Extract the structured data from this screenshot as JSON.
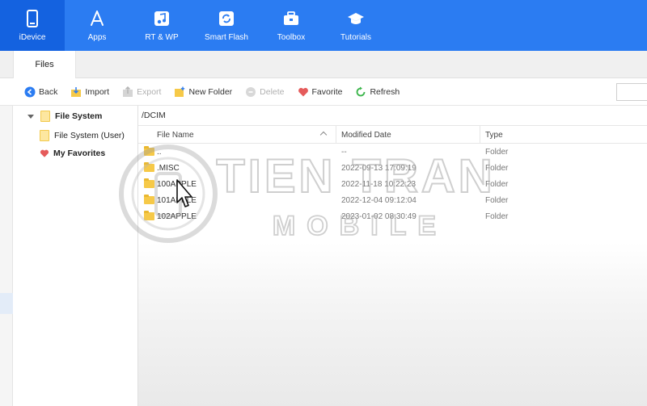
{
  "nav": {
    "items": [
      {
        "label": "iDevice",
        "icon": "phone-icon",
        "active": true
      },
      {
        "label": "Apps",
        "icon": "app-store-icon"
      },
      {
        "label": "RT & WP",
        "icon": "music-icon"
      },
      {
        "label": "Smart Flash",
        "icon": "flash-icon"
      },
      {
        "label": "Toolbox",
        "icon": "toolbox-icon"
      },
      {
        "label": "Tutorials",
        "icon": "graduation-cap-icon"
      }
    ]
  },
  "tabs": {
    "files": "Files"
  },
  "toolbar": {
    "back": "Back",
    "import": "Import",
    "export": "Export",
    "new_folder": "New Folder",
    "delete": "Delete",
    "favorite": "Favorite",
    "refresh": "Refresh"
  },
  "tree": {
    "file_system": "File System",
    "file_system_user": "File System (User)",
    "my_favorites": "My Favorites"
  },
  "path": "/DCIM",
  "table": {
    "headers": {
      "name": "File Name",
      "modified": "Modified Date",
      "type": "Type"
    },
    "rows": [
      {
        "name": "..",
        "modified": "--",
        "type": "Folder"
      },
      {
        "name": ".MISC",
        "modified": "2022-09-13 17:09:19",
        "type": "Folder"
      },
      {
        "name": "100APPLE",
        "modified": "2022-11-18 10:22:23",
        "type": "Folder"
      },
      {
        "name": "101APPLE",
        "modified": "2022-12-04 09:12:04",
        "type": "Folder"
      },
      {
        "name": "102APPLE",
        "modified": "2023-01-02 08:30:49",
        "type": "Folder"
      }
    ]
  },
  "watermark": {
    "line1": "TIEN TRAN",
    "line2": "MOBILE"
  },
  "colors": {
    "accent": "#2b7cf2",
    "active_nav": "#1462e0",
    "folder": "#f6c948"
  }
}
